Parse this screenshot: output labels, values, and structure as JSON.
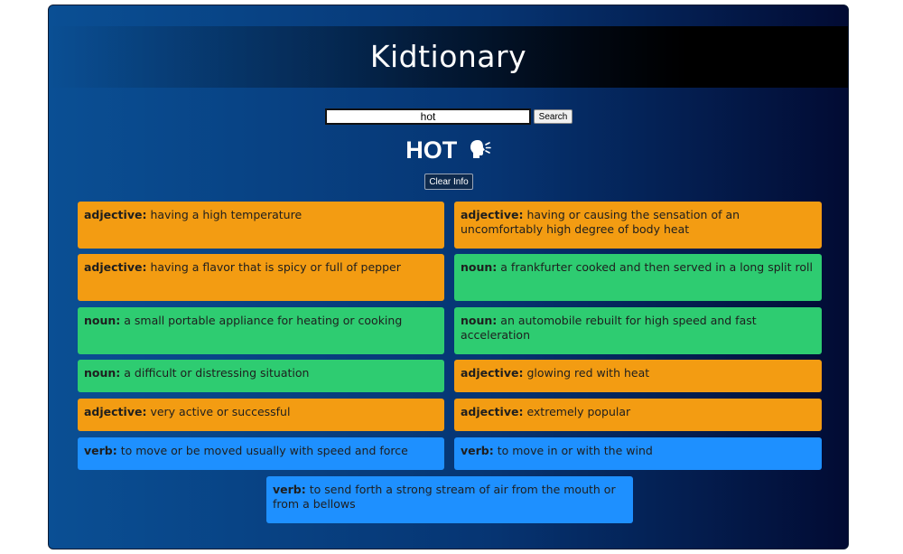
{
  "app": {
    "title": "Kidtionary"
  },
  "search": {
    "value": "hot",
    "button_label": "Search"
  },
  "result": {
    "word": "HOT",
    "clear_label": "Clear Info"
  },
  "definitions": [
    {
      "pos": "adjective:",
      "text": "having a high temperature"
    },
    {
      "pos": "adjective:",
      "text": "having or causing the sensation of an uncomfortably high degree of body heat"
    },
    {
      "pos": "adjective:",
      "text": "having a flavor that is spicy or full of pepper"
    },
    {
      "pos": "noun:",
      "text": "a frankfurter cooked and then served in a long split roll"
    },
    {
      "pos": "noun:",
      "text": "a small portable appliance for heating or cooking"
    },
    {
      "pos": "noun:",
      "text": "an automobile rebuilt for high speed and fast acceleration"
    },
    {
      "pos": "noun:",
      "text": "a difficult or distressing situation"
    },
    {
      "pos": "adjective:",
      "text": "glowing red with heat"
    },
    {
      "pos": "adjective:",
      "text": "very active or successful"
    },
    {
      "pos": "adjective:",
      "text": "extremely popular"
    },
    {
      "pos": "verb:",
      "text": "to move or be moved usually with speed and force"
    },
    {
      "pos": "verb:",
      "text": "to move in or with the wind"
    },
    {
      "pos": "verb:",
      "text": "to send forth a strong stream of air from the mouth or from a bellows"
    }
  ],
  "colors": {
    "adjective": "#f39c12",
    "noun": "#2ecc71",
    "verb": "#1e90ff"
  },
  "icons": {
    "speak": "speaking-head-icon"
  }
}
